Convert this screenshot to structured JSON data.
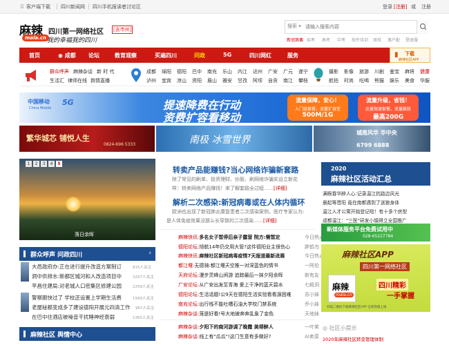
{
  "topbar": {
    "client_download": "客户端下载",
    "sichuan_news": "四川新闻网",
    "mobile_forum": "四川手机报读者讨论区",
    "login": "登录",
    "register": "注册",
    "or": "或"
  },
  "header": {
    "logo_text": "麻辣",
    "logo_badge": "mala.cn",
    "site_name": "四川第一网络社区",
    "city_tag": "[去市州]",
    "slogan": "我的幸福我的四川"
  },
  "search": {
    "type_label": "搜索",
    "placeholder": "请输入搜索内容",
    "keywords": [
      "新冠病毒",
      "招考",
      "高考",
      "中考",
      "校外培训",
      "择校",
      "落户配",
      "登退服"
    ]
  },
  "nav": {
    "items": [
      "首页",
      "成都",
      "论坛",
      "教育观察",
      "买遍四川",
      "问政",
      "5G",
      "四川网红",
      "服务"
    ],
    "download_label": "下载",
    "download_sub": "麻辣社区APP"
  },
  "categories": {
    "group1": [
      "群众呼声",
      "麻辣杂谈",
      "新 时 代",
      "生活汇",
      "律师在线",
      "舆情直播"
    ],
    "group2": [
      "成都",
      "绵阳",
      "德阳",
      "巴中",
      "南充",
      "乐山",
      "内江",
      "达州",
      "广安",
      "广元",
      "遂宁",
      "泸州",
      "宜宾",
      "凉山",
      "资阳",
      "眉山",
      "雅安",
      "甘孜",
      "阿坝",
      "自贡",
      "南江",
      "攀枝",
      "南部"
    ],
    "group3": [
      "摄影",
      "影像",
      "旅游",
      "川剧",
      "鉴宝",
      "麻将",
      "健康",
      "航拍",
      "时尚",
      "吃喝",
      "熊猫",
      "娱乐",
      "美食",
      "华服"
    ]
  },
  "banners": {
    "cm_logo": "中国移动",
    "cm_sub": "China Mobile",
    "cm_5g": "5G",
    "cm_title1": "提速降费在行动",
    "cm_title2": "资费扩容看移动",
    "pill1_a": "流量保障，安心！",
    "pill1_b": "入门级套餐，流量扩容至",
    "pill1_c": "500M/1G",
    "pill2_a": "流量升级，省钱！",
    "pill2_b": "达量限速套餐，流量膨胀",
    "pill2_c": "最高200G",
    "a_title": "繁华城芯 铺悦人生",
    "a_phone": "0824-696 5333",
    "b_title": "南极 冰雪世界",
    "c_title": "城南风华 华中央",
    "c_phone": "6799 6888"
  },
  "slideshow": {
    "pages": [
      "1",
      "2",
      "3",
      "4",
      "5"
    ],
    "caption": "落日余晖"
  },
  "headlines": [
    {
      "title": "转卖产品能赚钱?当心网络诈骗新套路",
      "desc1": "除了常见的刷单、投资理财、炒股、刷网络诈骗实设立新花",
      "desc2": "样：转卖网络产品赚钱！来了解套路全过程……",
      "more": "[详细]"
    },
    {
      "title": "解析二次感染:新冠病毒或在人体内循环",
      "desc1": "欧洲也出现了新冠肺炎康复患者二次感染案例，医疗专家认为:",
      "desc2": "是人体免疫效果没那么长导致的二次感染……",
      "more": "[详细]"
    }
  ],
  "left_section1": {
    "title": "群众呼声 问政四川",
    "more": "›",
    "items": [
      {
        "text": "大邑政府办:正在进行提升改造方案制订",
        "meta": "815人关注"
      },
      {
        "text": "洞中供排水:新都区城河和人改造项目中",
        "meta": "3297人关注"
      },
      {
        "text": "平昌住建局:对老城人口密集区修建公园",
        "meta": "2258人关注"
      },
      {
        "text": "警察跟快过了 学校还设置上学期生活费",
        "meta": "1569人关注"
      },
      {
        "text": "老屋秘都变成多了建设德阳开展元四清工作",
        "meta": "967人关注"
      },
      {
        "text": "在巴中往酒店被噪音干扰睡神经衰弱",
        "meta": "1365人关注"
      }
    ]
  },
  "left_section2": {
    "title": "麻辣社区 舆情中心"
  },
  "mid_list": [
    {
      "src": "麻辣快讯:",
      "text": "多名女子暂停后亲子露营 院方:需暂定",
      "author": "今日热点"
    },
    {
      "src": "德阳论坛:",
      "text": "旭航14年仍交用大管?这件德阳业主很伤心",
      "author": "胖鹤鸟"
    },
    {
      "src": "麻辣快讯:",
      "text": "麻辣社区新冠病毒疫情7天报道最新进展",
      "author": "今日热点"
    },
    {
      "src": "都江堰:",
      "text": "无德骑:都江堰天空推一对深蓝色的情书",
      "author": "一阿伦"
    },
    {
      "src": "天府论坛:",
      "text": "漫步灵峰山闲游 追踪最后一抹夕阳余晖",
      "author": "新有友"
    },
    {
      "src": "广安论坛:",
      "text": "从广安出发至青海 爱上干净的蓝天碧水",
      "author": "七殿洞"
    },
    {
      "src": "德阳论坛:",
      "text": "生活话题!公9天在德阳生活实验看看源困难",
      "author": "苏小妹"
    },
    {
      "src": "南充论坛:",
      "text": "出行栈不能吐槽石油大学校门禁系统",
      "author": "乔小妹"
    },
    {
      "src": "麻辣杂谈:",
      "text": "笼是好看!号大地被奔奔乱象了金色",
      "author": "天地妹"
    },
    {
      "src": "麻辣杂谈:",
      "text": "夕阳下的南河游调了晚霞 美得醉人",
      "author": "一叶笑"
    },
    {
      "src": "麻辣杂谈:",
      "text": "线上有\"瓜瓜\"!这门生意有多做好?",
      "author": "AI卖菜"
    }
  ],
  "right_col": {
    "year": "2020",
    "title": "麻辣社区活动汇总",
    "items": [
      "满眼春华醉人心:记录温江抗路边风光",
      "晨起等晋阳 竟在南都遇到了送狼身体",
      "温江人才公寓开始登记啦！有十多个房型",
      "成都温江：\"三医\"研发小镇得立全国推广"
    ],
    "ad1_title": "新媒体服务平台免费试用中",
    "ad1_phone": "028-65227784",
    "ad2_title": "麻辣社区APP",
    "ad2_tag": "四川第一网络社区",
    "ad2_logo": "麻辣",
    "ad2_logo_badge": "mala.cn",
    "ad2_slogan1": "四川精彩",
    "ad2_slogan2": "一手掌握",
    "ad2_foot": "扫描二维码下载麻辣社区APP 全新改版上线",
    "tip_title": "社区小提示",
    "tip_1": "2020年麻辣社区转变管理体制"
  }
}
